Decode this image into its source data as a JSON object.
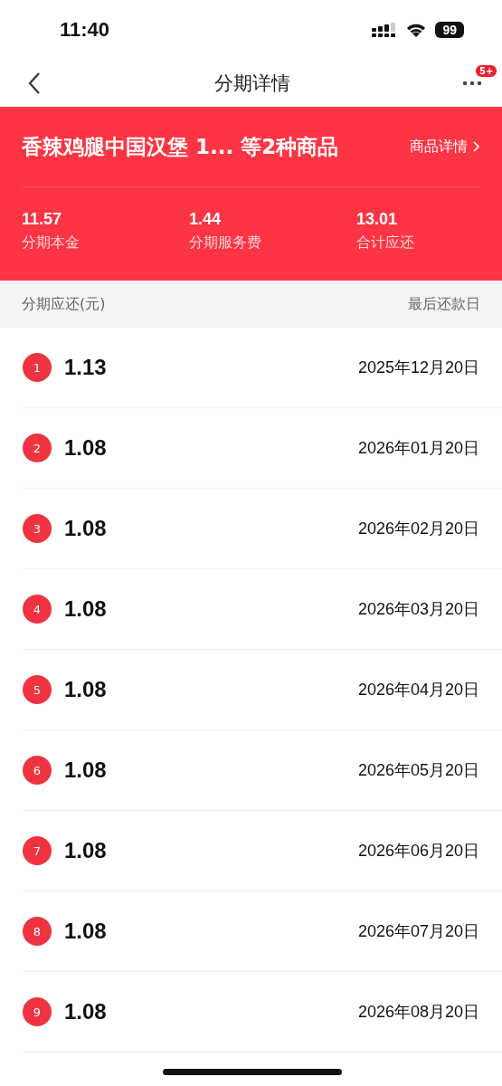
{
  "status_bar": {
    "time": "11:40",
    "battery": "99"
  },
  "nav": {
    "title": "分期详情",
    "badge": "5+"
  },
  "summary": {
    "title": "香辣鸡腿中国汉堡 1... 等2种商品",
    "link": "商品详情",
    "stats": [
      {
        "value": "11.57",
        "label": "分期本金"
      },
      {
        "value": "1.44",
        "label": "分期服务费"
      },
      {
        "value": "13.01",
        "label": "合计应还"
      }
    ]
  },
  "table": {
    "columns": [
      "分期应还(元)",
      "最后还款日"
    ],
    "rows": [
      {
        "index": "1",
        "amount": "1.13",
        "due_date": "2025年12月20日"
      },
      {
        "index": "2",
        "amount": "1.08",
        "due_date": "2026年01月20日"
      },
      {
        "index": "3",
        "amount": "1.08",
        "due_date": "2026年02月20日"
      },
      {
        "index": "4",
        "amount": "1.08",
        "due_date": "2026年03月20日"
      },
      {
        "index": "5",
        "amount": "1.08",
        "due_date": "2026年04月20日"
      },
      {
        "index": "6",
        "amount": "1.08",
        "due_date": "2026年05月20日"
      },
      {
        "index": "7",
        "amount": "1.08",
        "due_date": "2026年06月20日"
      },
      {
        "index": "8",
        "amount": "1.08",
        "due_date": "2026年07月20日"
      },
      {
        "index": "9",
        "amount": "1.08",
        "due_date": "2026年08月20日"
      }
    ]
  }
}
